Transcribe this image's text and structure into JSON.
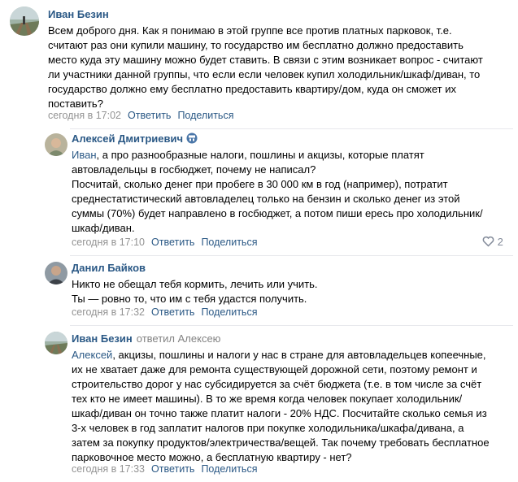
{
  "accent_color": "#2a5885",
  "comments": [
    {
      "author": "Иван Безин",
      "lines": [
        "Всем доброго дня. Как я понимаю в этой группе все против платных парковок, т.е.",
        "считают раз они купили машину, то государство им бесплатно должно предоставить",
        "место куда эту машину можно будет ставить. В связи с этим возникает вопрос - считают",
        "ли участники данной группы, что если если человек купил холодильник/шкаф/диван, то",
        "государство должно ему бесплатно предоставить квартиру/дом, куда он сможет их",
        "поставить?"
      ],
      "time": "сегодня в 17:02",
      "reply_label": "Ответить",
      "share_label": "Поделиться"
    },
    {
      "author": "Алексей Дмитриевич",
      "badge_icon": "blue-badge-icon",
      "mention": "Иван",
      "lines": [
        ", а про разнообразные налоги, пошлины и акцизы, которые платят",
        "автовладельцы в госбюджет, почему не написал?",
        "Посчитай, сколько денег при пробеге в 30 000 км в год (например), потратит",
        "среднестатистический автовладелец только на бензин и сколько денег из этой",
        "суммы (70%) будет направлено в госбюджет, а потом пиши ересь про холодильник/",
        "шкаф/диван."
      ],
      "time": "сегодня в 17:10",
      "reply_label": "Ответить",
      "share_label": "Поделиться",
      "likes": "2"
    },
    {
      "author": "Данил Байков",
      "lines": [
        "Никто не обещал тебя кормить, лечить или учить.",
        "Ты — ровно то, что им с тебя удастся получить."
      ],
      "time": "сегодня в 17:32",
      "reply_label": "Ответить",
      "share_label": "Поделиться"
    },
    {
      "author": "Иван Безин",
      "reply_to": "ответил Алексею",
      "mention": "Алексей",
      "lines": [
        ", акцизы, пошлины и налоги у нас в стране для автовладельцев копеечные,",
        "их не хватает даже для ремонта существующей дорожной сети, поэтому ремонт и",
        "строительство дорог у нас субсидируется за счёт бюджета (т.е. в том числе за счёт",
        "тех кто не имеет машины). В то же время когда человек покупает холодильник/",
        "шкаф/диван он точно также платит налоги - 20% НДС. Посчитайте сколько семья из",
        "3-х человек в год заплатит налогов при покупке холодильника/шкафа/дивана, а",
        "затем за покупку продуктов/электричества/вещей. Так почему требовать бесплатное",
        "парковочное место можно, а бесплатную квартиру - нет?"
      ],
      "time": "сегодня в 17:33",
      "reply_label": "Ответить",
      "share_label": "Поделиться"
    }
  ]
}
